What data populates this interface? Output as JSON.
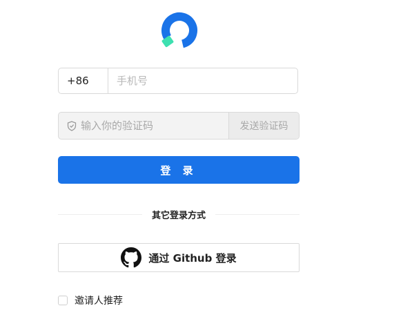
{
  "logo": {
    "icon": "brand-logo-icon",
    "colors": {
      "primary": "#1a73e8",
      "accent": "#3ee0b0"
    }
  },
  "phone": {
    "country_code": "+86",
    "placeholder": "手机号",
    "value": ""
  },
  "verification": {
    "placeholder": "输入你的验证码",
    "value": "",
    "send_label": "发送验证码",
    "icon": "shield-icon"
  },
  "login": {
    "label": "登 录",
    "color": "#1a73e8"
  },
  "divider": {
    "label": "其它登录方式"
  },
  "github": {
    "label": "通过 Github 登录",
    "icon": "github-icon"
  },
  "invite": {
    "label": "邀请人推荐",
    "checked": false
  }
}
